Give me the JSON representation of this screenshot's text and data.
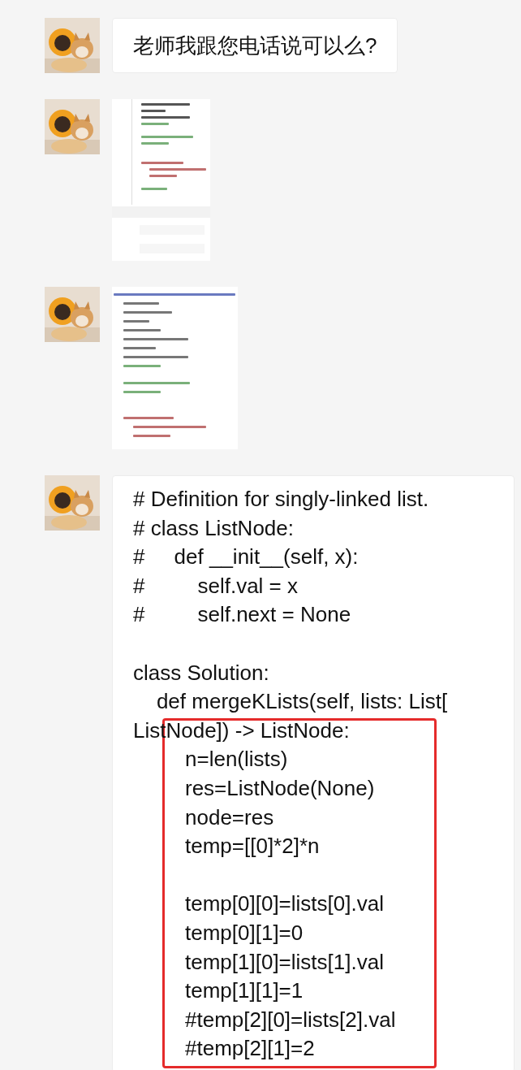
{
  "messages": [
    {
      "kind": "text",
      "text": "老师我跟您电话说可以么?"
    },
    {
      "kind": "picture"
    },
    {
      "kind": "picture"
    },
    {
      "kind": "code",
      "lines": [
        {
          "text": "# Definition for singly-linked list."
        },
        {
          "text": "# class ListNode:"
        },
        {
          "text": "#     def __init__(self, x):"
        },
        {
          "text": "#         self.val = x"
        },
        {
          "text": "#         self.next = None"
        },
        {
          "text": "class Solution:",
          "gap_before": true
        },
        {
          "text": "    def mergeKLists(self, lists: List["
        },
        {
          "text": "ListNode]) -> ListNode:"
        }
      ],
      "highlight": {
        "lines": [
          {
            "text": "n=len(lists)"
          },
          {
            "text": "res=ListNode(None)"
          },
          {
            "text": "node=res"
          },
          {
            "text": "temp=[[0]*2]*n"
          },
          {
            "text": "temp[0][0]=lists[0].val",
            "gap_before": true
          },
          {
            "text": "temp[0][1]=0"
          },
          {
            "text": "temp[1][0]=lists[1].val"
          },
          {
            "text": "temp[1][1]=1"
          },
          {
            "text": "#temp[2][0]=lists[2].val"
          },
          {
            "text": "#temp[2][1]=2"
          }
        ]
      }
    }
  ]
}
